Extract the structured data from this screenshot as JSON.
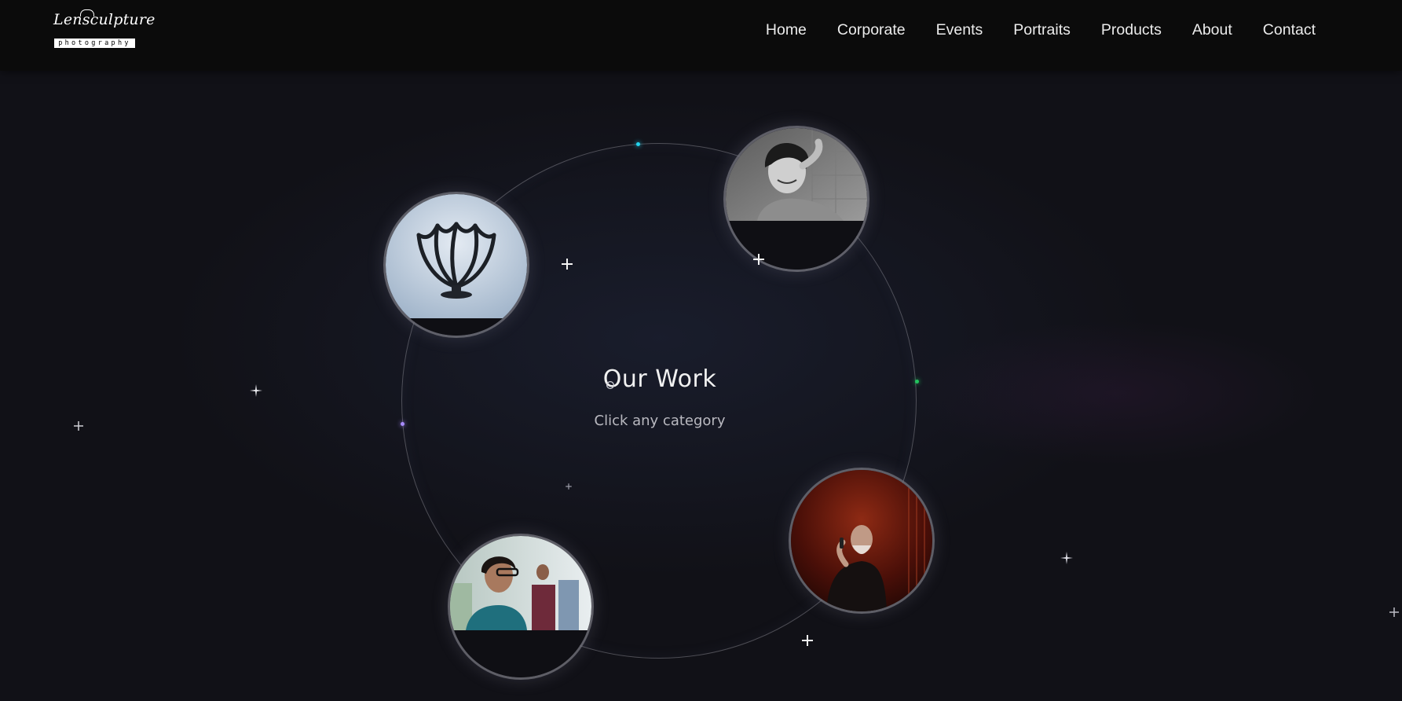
{
  "brand": {
    "name": "Lensculpture",
    "tagline": "photography"
  },
  "nav": {
    "items": [
      {
        "label": "Home"
      },
      {
        "label": "Corporate"
      },
      {
        "label": "Events"
      },
      {
        "label": "Portraits"
      },
      {
        "label": "Products"
      },
      {
        "label": "About"
      },
      {
        "label": "Contact"
      }
    ]
  },
  "hero": {
    "title": "Our Work",
    "subtitle": "Click any category"
  },
  "categories": [
    {
      "icon": "product-bowl-photo"
    },
    {
      "icon": "portrait-photo"
    },
    {
      "icon": "event-singer-photo"
    },
    {
      "icon": "corporate-photo"
    }
  ],
  "colors": {
    "background": "#111117",
    "navbar": "#0b0b0b",
    "orbit_dot_cyan": "#22d3ee",
    "orbit_dot_green": "#22c55e",
    "orbit_dot_purple": "#a78bfa"
  }
}
